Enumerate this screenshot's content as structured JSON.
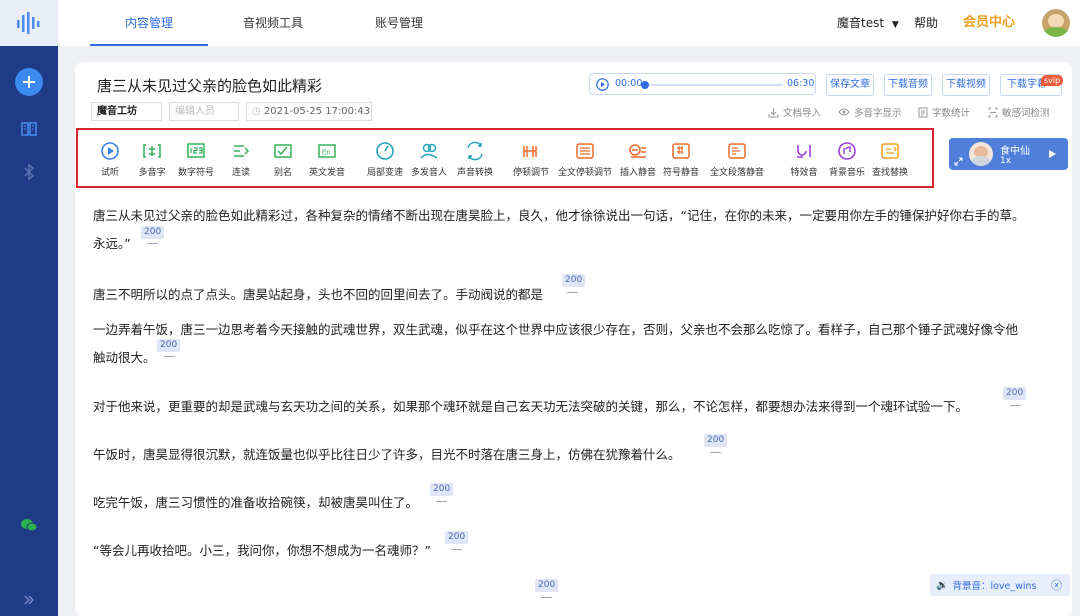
{
  "nav": {
    "tabs": [
      "内容管理",
      "音视频工具",
      "账号管理"
    ],
    "user": "魔音test",
    "help": "帮助",
    "vip": "会员中心"
  },
  "document": {
    "title": "唐三从未见过父亲的脸色如此精彩",
    "source": "魔音工坊",
    "editor_placeholder": "编辑人员",
    "date": "2021-05-25 17:00:43",
    "audio_start": "00:00",
    "audio_end": "06:30",
    "progress": 0,
    "buttons": [
      "保存文章",
      "下载音频",
      "下载视频",
      "下载字幕"
    ],
    "svip_badge": "svip",
    "actions": [
      "文档导入",
      "多音字显示",
      "字数统计",
      "敏感词检测"
    ]
  },
  "tools": [
    {
      "label": "试听",
      "icon": "play-circle-icon",
      "color": "#3a82e8"
    },
    {
      "label": "多音字",
      "icon": "polyphone-icon",
      "color": "#35b25a"
    },
    {
      "label": "数字符号",
      "icon": "number-icon",
      "color": "#35b25a"
    },
    {
      "label": "连读",
      "icon": "liaison-icon",
      "color": "#35b25a"
    },
    {
      "label": "别名",
      "icon": "alias-icon",
      "color": "#35b25a"
    },
    {
      "label": "英文发音",
      "icon": "english-icon",
      "color": "#35b25a"
    },
    {
      "label": "局部变速",
      "icon": "speed-icon",
      "color": "#1fa3b8"
    },
    {
      "label": "多发音人",
      "icon": "speakers-icon",
      "color": "#1fa3b8"
    },
    {
      "label": "声音转换",
      "icon": "voice-convert-icon",
      "color": "#1fa3b8"
    },
    {
      "label": "停顿调节",
      "icon": "pause-adjust-icon",
      "color": "#f06a2a"
    },
    {
      "label": "全文停顿调节",
      "icon": "full-pause-icon",
      "color": "#f06a2a"
    },
    {
      "label": "插入静音",
      "icon": "insert-silence-icon",
      "color": "#f06a2a"
    },
    {
      "label": "符号静音",
      "icon": "symbol-silence-icon",
      "color": "#f06a2a"
    },
    {
      "label": "全文段落静音",
      "icon": "paragraph-silence-icon",
      "color": "#f06a2a"
    },
    {
      "label": "特效音",
      "icon": "sound-effect-icon",
      "color": "#9b3fd8"
    },
    {
      "label": "背景音乐",
      "icon": "bgm-icon",
      "color": "#9b3fd8"
    },
    {
      "label": "查找替换",
      "icon": "find-replace-icon",
      "color": "#f0a020"
    }
  ],
  "voice": {
    "name": "食中仙",
    "speed": "1x"
  },
  "paragraphs": [
    {
      "lines": [
        "唐三从未见过父亲的脸色如此精彩过，各种复杂的情绪不断出现在唐昊脸上，良久，他才徐徐说出一句话，“记住，在你的未来，一定要用你左手的锤保护好你右手的草。",
        "永远。”"
      ],
      "pause": "200"
    },
    {
      "lines": [
        "唐三不明所以的点了点头。唐昊站起身，头也不回的回里间去了。手动阀说的都是"
      ],
      "pause": "200"
    },
    {
      "lines": [
        "一边弄着午饭，唐三一边思考着今天接触的武魂世界，双生武魂，似乎在这个世界中应该很少存在，否则，父亲也不会那么吃惊了。看样子，自己那个锤子武魂好像令他",
        "触动很大。"
      ],
      "pause": "200"
    },
    {
      "lines": [
        "对于他来说，更重要的却是武魂与玄天功之间的关系，如果那个魂环就是自己玄天功无法突破的关键，那么，不论怎样，都要想办法来得到一个魂环试验一下。"
      ],
      "pause": "200"
    },
    {
      "lines": [
        "午饭时，唐昊显得很沉默，就连饭量也似乎比往日少了许多，目光不时落在唐三身上，仿佛在犹豫着什么。"
      ],
      "pause": "200"
    },
    {
      "lines": [
        "吃完午饭，唐三习惯性的准备收拾碗筷，却被唐昊叫住了。"
      ],
      "pause": "200"
    },
    {
      "lines": [
        "“等会儿再收拾吧。小三，我问你，你想不想成为一名魂师？”"
      ],
      "pause": "200"
    },
    {
      "lines": [
        ""
      ],
      "pause": "200"
    }
  ],
  "bgm": {
    "label": "背景音：love_wins"
  }
}
